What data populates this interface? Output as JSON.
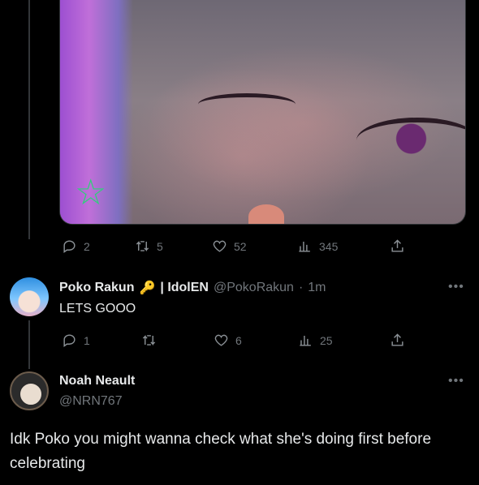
{
  "main_tweet": {
    "media_alt": "",
    "actions": {
      "replies": "2",
      "retweets": "5",
      "likes": "52",
      "views": "345"
    }
  },
  "reply1": {
    "display_name": "Poko Rakun",
    "emoji": "🔑",
    "name_suffix": "| IdolEN",
    "handle": "@PokoRakun",
    "separator": "·",
    "time": "1m",
    "text": "LETS GOOO",
    "actions": {
      "replies": "1",
      "retweets": "",
      "likes": "6",
      "views": "25"
    },
    "more": "•••"
  },
  "reply2": {
    "display_name": "Noah Neault",
    "handle": "@NRN767",
    "text": "Idk Poko you might wanna check what she's doing first before celebrating",
    "more": "•••"
  },
  "icons": [
    "reply-icon",
    "retweet-icon",
    "like-icon",
    "views-icon",
    "share-icon"
  ],
  "colors": {
    "background": "#000000",
    "text": "#e7e9ea",
    "muted": "#71767b",
    "divider": "#333639"
  }
}
